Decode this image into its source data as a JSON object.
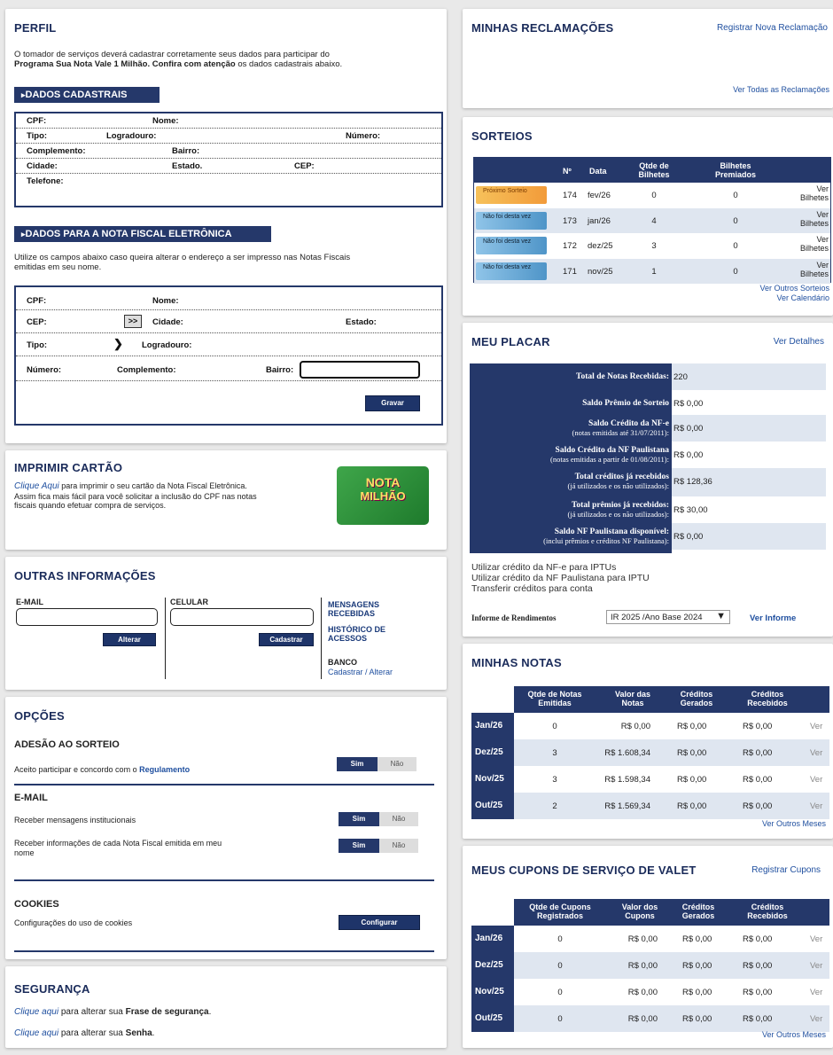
{
  "perfil": {
    "title": "PERFIL",
    "intro_1": "O tomador de serviços deverá cadastrar corretamente seus dados para participar do",
    "intro_2_bold": "Programa Sua Nota Vale 1 Milhão. Confira com atenção",
    "intro_2_rest": " os dados cadastrais abaixo.",
    "dados_cadastrais": "DADOS CADASTRAIS",
    "fields": {
      "cpf": "CPF:",
      "nome": "Nome:",
      "tipo": "Tipo:",
      "logradouro": "Logradouro:",
      "numero": "Número:",
      "complemento": "Complemento:",
      "bairro": "Bairro:",
      "cidade": "Cidade:",
      "estado": "Estado.",
      "cep": "CEP:",
      "telefone": "Telefone:"
    },
    "nf_title": "DADOS PARA A NOTA FISCAL ELETRÔNICA",
    "nf_intro_1": "Utilize os campos abaixo caso queira alterar o endereço a ser impresso nas Notas Fiscais",
    "nf_intro_2": "emitidas em seu nome.",
    "nf_fields": {
      "cpf": "CPF:",
      "nome": "Nome:",
      "cep": "CEP:",
      "cep_btn": ">>",
      "cidade": "Cidade:",
      "estado": "Estado:",
      "tipo": "Tipo:",
      "logradouro": "Logradouro:",
      "numero": "Número:",
      "complemento": "Complemento:",
      "bairro": "Bairro:"
    },
    "gravar": "Gravar"
  },
  "imprimir": {
    "title": "IMPRIMIR CARTÃO",
    "link": "Clique Aqui",
    "text_1": " para imprimir o seu cartão da Nota Fiscal Eletrônica.",
    "text_2": "Assim fica mais fácil para você solicitar a inclusão do CPF nas notas",
    "text_3": "fiscais quando efetuar compra de serviços.",
    "card_line1": "NOTA",
    "card_line2": "MILHÃO"
  },
  "outras": {
    "title": "OUTRAS INFORMAÇÕES",
    "email_label": "E-MAIL",
    "celular_label": "CELULAR",
    "alterar": "Alterar",
    "cadastrar": "Cadastrar",
    "mensagens_1": "MENSAGENS",
    "mensagens_2": "RECEBIDAS",
    "historico_1": "HISTÓRICO DE",
    "historico_2": "ACESSOS",
    "banco": "BANCO",
    "banco_link": "Cadastrar / Alterar"
  },
  "opcoes": {
    "title": "OPÇÕES",
    "adesao_title": "ADESÃO AO SORTEIO",
    "adesao_text": "Aceito participar e concordo com o ",
    "regulamento": "Regulamento",
    "email_title": "E-MAIL",
    "email_opt1": "Receber mensagens institucionais",
    "email_opt2a": "Receber informações de cada Nota Fiscal emitida em meu",
    "email_opt2b": "nome",
    "cookies_title": "COOKIES",
    "cookies_text": "Configurações do uso de cookies",
    "configurar": "Configurar",
    "sim": "Sim",
    "nao": "Não"
  },
  "seguranca": {
    "title": "SEGURANÇA",
    "link": "Clique aqui",
    "line1_text": " para alterar sua ",
    "line1_bold": "Frase de segurança",
    "line2_text": " para alterar sua ",
    "line2_bold": "Senha"
  },
  "reclamacoes": {
    "title": "MINHAS RECLAMAÇÕES",
    "registrar": "Registrar Nova Reclamação",
    "ver_todas": "Ver Todas as Reclamações"
  },
  "sorteios": {
    "title": "SORTEIOS",
    "headers": [
      "Nº",
      "Data",
      "Qtde de Bilhetes",
      "Bilhetes Premiados"
    ],
    "rows": [
      {
        "badge": "Próximo Sorteio",
        "num": "174",
        "data": "fev/26",
        "qtde": "0",
        "premiados": "0",
        "link": "Ver Bilhetes"
      },
      {
        "badge": "Não foi desta vez",
        "num": "173",
        "data": "jan/26",
        "qtde": "4",
        "premiados": "0",
        "link": "Ver Bilhetes"
      },
      {
        "badge": "Não foi desta vez",
        "num": "172",
        "data": "dez/25",
        "qtde": "3",
        "premiados": "0",
        "link": "Ver Bilhetes"
      },
      {
        "badge": "Não foi desta vez",
        "num": "171",
        "data": "nov/25",
        "qtde": "1",
        "premiados": "0",
        "link": "Ver Bilhetes"
      }
    ],
    "ver_outros": "Ver Outros Sorteios",
    "ver_calendario": "Ver Calendário"
  },
  "placar": {
    "title": "MEU PLACAR",
    "ver_detalhes": "Ver Detalhes",
    "rows": [
      {
        "label": "Total de Notas Recebidas:",
        "sub": "",
        "value": "220"
      },
      {
        "label": "Saldo Prêmio de Sorteio",
        "sub": "",
        "value": "R$ 0,00"
      },
      {
        "label": "Saldo Crédito da NF-e",
        "sub": "(notas emitidas até 31/07/2011):",
        "value": "R$ 0,00"
      },
      {
        "label": "Saldo Crédito da NF Paulistana",
        "sub": "(notas emitidas a partir de 01/08/2011):",
        "value": "R$ 0,00"
      },
      {
        "label": "Total créditos já recebidos",
        "sub": "(já utilizados e os não utilizados):",
        "value": "R$ 128,36"
      },
      {
        "label": "Total prêmios já recebidos:",
        "sub": "(já utilizados e os não utilizados):",
        "value": "R$ 30,00"
      },
      {
        "label": "Saldo NF Paulistana disponível:",
        "sub": "(inclui prêmios e créditos NF Paulistana):",
        "value": "R$ 0,00"
      }
    ],
    "link1": "Utilizar crédito da NF-e para IPTUs",
    "link2": "Utilizar crédito da NF Paulistana para IPTU",
    "link3": "Transferir créditos para conta",
    "informe_label": "Informe de Rendimentos",
    "informe_select": "IR 2025 /Ano Base 2024",
    "ver_informe": "Ver Informe"
  },
  "notas": {
    "title": "MINHAS NOTAS",
    "headers": [
      "Qtde de Notas Emitidas",
      "Valor das Notas",
      "Créditos Gerados",
      "Créditos Recebidos"
    ],
    "rows": [
      {
        "mes": "Jan/26",
        "qtde": "0",
        "valor": "R$ 0,00",
        "gerados": "R$ 0,00",
        "recebidos": "R$ 0,00",
        "ver": "Ver"
      },
      {
        "mes": "Dez/25",
        "qtde": "3",
        "valor": "R$ 1.608,34",
        "gerados": "R$ 0,00",
        "recebidos": "R$ 0,00",
        "ver": "Ver"
      },
      {
        "mes": "Nov/25",
        "qtde": "3",
        "valor": "R$ 1.598,34",
        "gerados": "R$ 0,00",
        "recebidos": "R$ 0,00",
        "ver": "Ver"
      },
      {
        "mes": "Out/25",
        "qtde": "2",
        "valor": "R$ 1.569,34",
        "gerados": "R$ 0,00",
        "recebidos": "R$ 0,00",
        "ver": "Ver"
      }
    ],
    "ver_outros": "Ver Outros Meses"
  },
  "cupons": {
    "title": "MEUS CUPONS DE SERVIÇO DE VALET",
    "registrar": "Registrar Cupons",
    "headers": [
      "Qtde de Cupons Registrados",
      "Valor dos Cupons",
      "Créditos Gerados",
      "Créditos Recebidos"
    ],
    "rows": [
      {
        "mes": "Jan/26",
        "qtde": "0",
        "valor": "R$ 0,00",
        "gerados": "R$ 0,00",
        "recebidos": "R$ 0,00",
        "ver": "Ver"
      },
      {
        "mes": "Dez/25",
        "qtde": "0",
        "valor": "R$ 0,00",
        "gerados": "R$ 0,00",
        "recebidos": "R$ 0,00",
        "ver": "Ver"
      },
      {
        "mes": "Nov/25",
        "qtde": "0",
        "valor": "R$ 0,00",
        "gerados": "R$ 0,00",
        "recebidos": "R$ 0,00",
        "ver": "Ver"
      },
      {
        "mes": "Out/25",
        "qtde": "0",
        "valor": "R$ 0,00",
        "gerados": "R$ 0,00",
        "recebidos": "R$ 0,00",
        "ver": "Ver"
      }
    ],
    "ver_outros": "Ver Outros Meses"
  },
  "colors": {
    "navy": "#25386a",
    "link": "#1f4f9f",
    "stripe": "#dfe6f0"
  }
}
